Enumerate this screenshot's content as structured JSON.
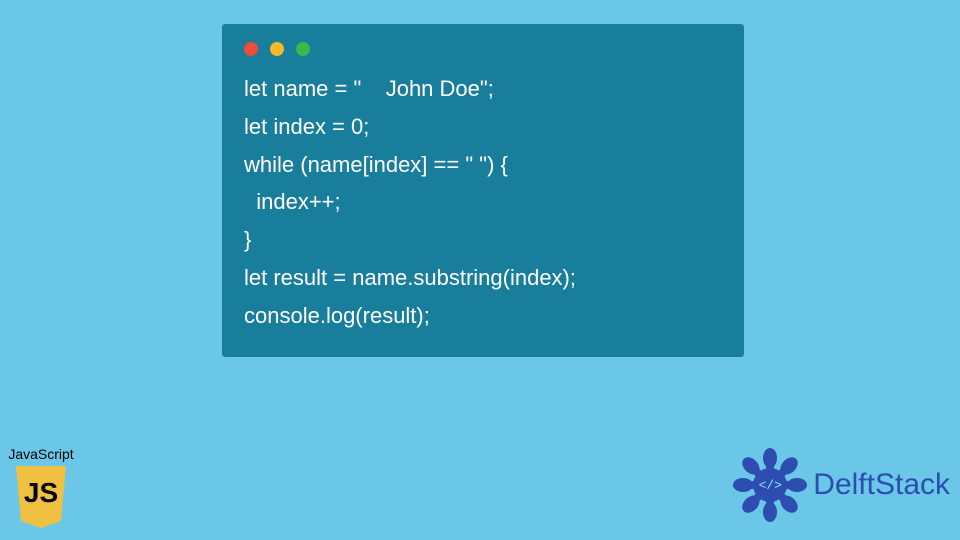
{
  "code": {
    "lines": [
      "let name = \"    John Doe\";",
      "let index = 0;",
      "while (name[index] == \" \") {",
      "  index++;",
      "}",
      "let result = name.substring(index);",
      "console.log(result);"
    ]
  },
  "js_badge": {
    "label": "JavaScript",
    "letters": "JS"
  },
  "delft": {
    "brand_first": "Delft",
    "brand_second": "Stack",
    "core_symbol": "</>"
  },
  "colors": {
    "page_bg": "#6bc7e8",
    "window_bg": "#187e9b",
    "brand_blue": "#2d4db1",
    "js_yellow": "#f0c040"
  }
}
